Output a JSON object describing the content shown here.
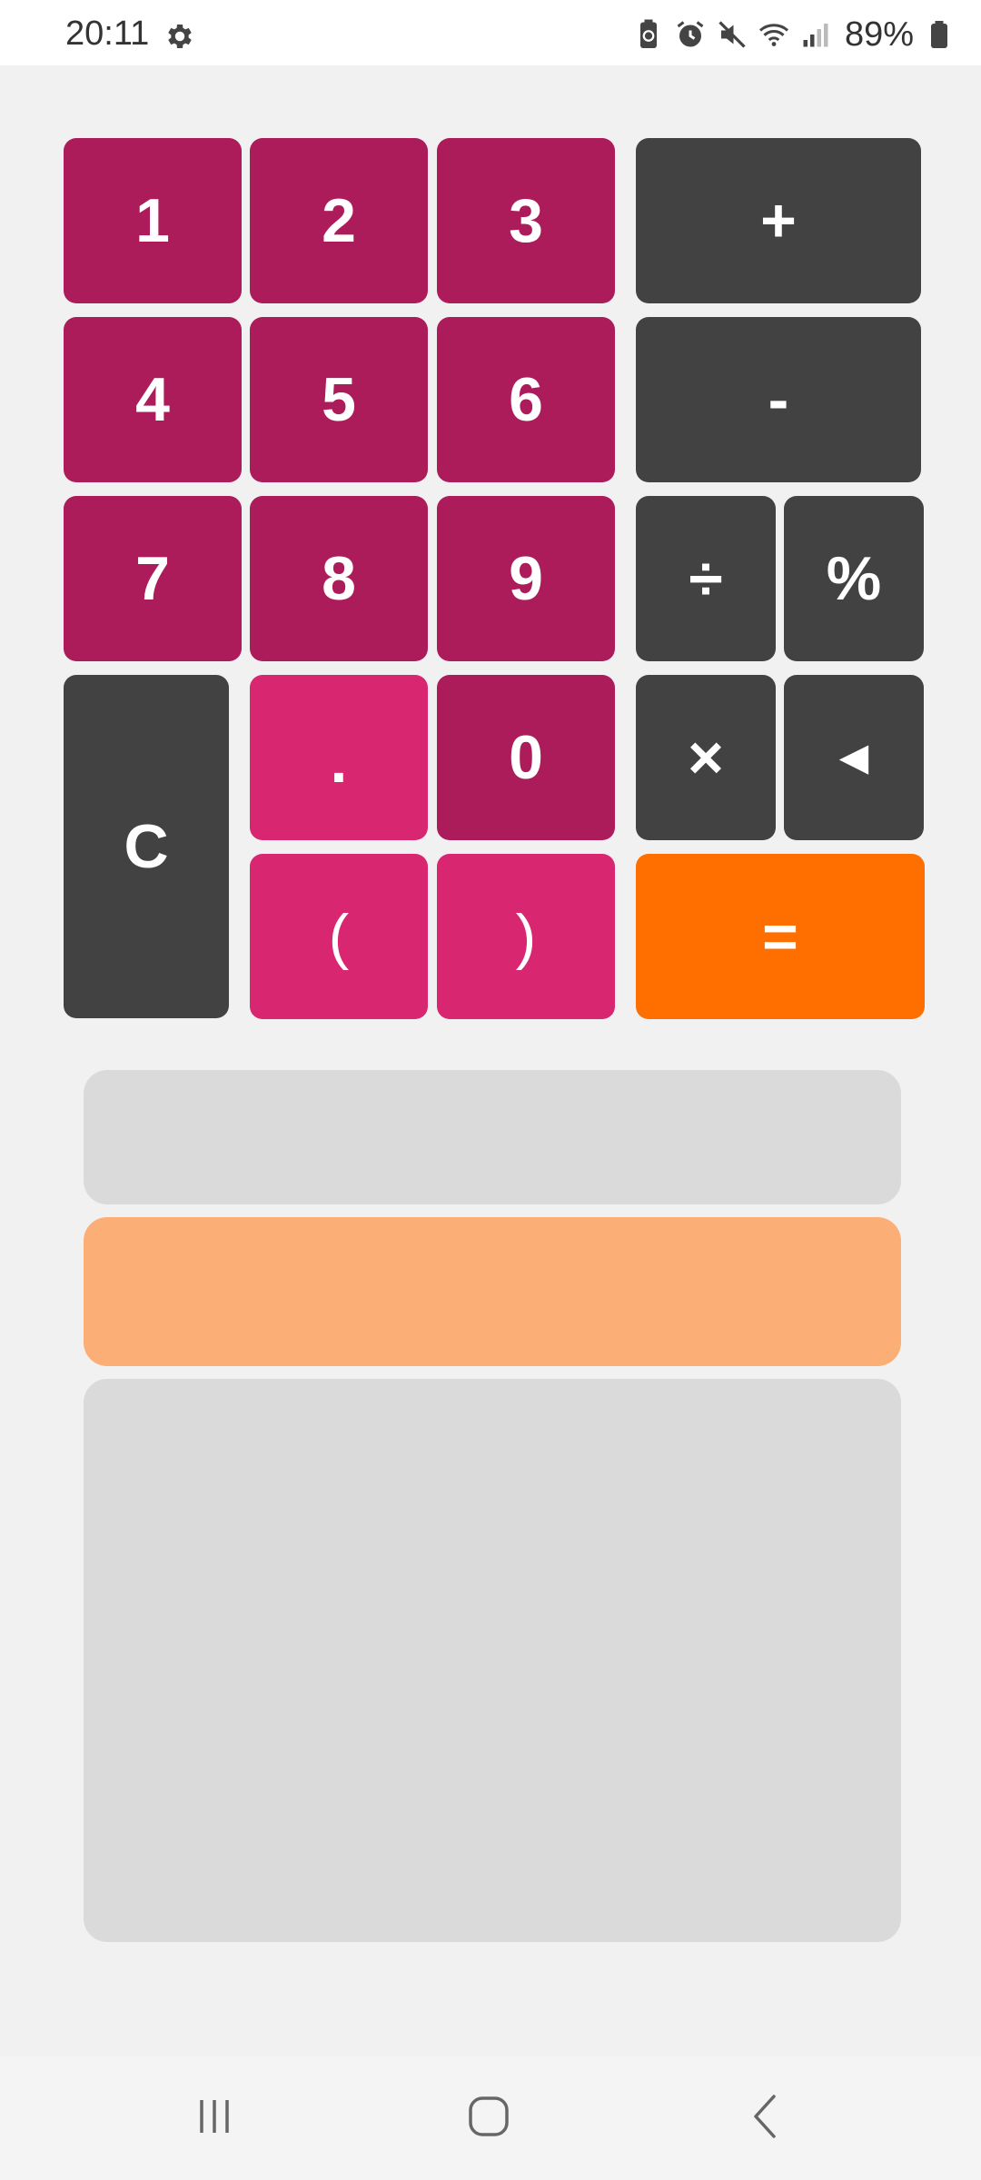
{
  "status_bar": {
    "time": "20:11",
    "battery_percent": "89%",
    "icons": [
      "settings-gear-icon",
      "battery-saver-icon",
      "alarm-icon",
      "mute-icon",
      "wifi-icon",
      "signal-icon",
      "battery-icon"
    ]
  },
  "keypad": {
    "k1": "1",
    "k2": "2",
    "k3": "3",
    "k4": "4",
    "k5": "5",
    "k6": "6",
    "k7": "7",
    "k8": "8",
    "k9": "9",
    "k0": "0",
    "dot": ".",
    "open_paren": "(",
    "close_paren": ")",
    "clear": "C",
    "plus": "+",
    "minus": "-",
    "divide": "÷",
    "percent": "%",
    "multiply": "×",
    "backspace": "◄",
    "equals": "="
  },
  "display": {
    "expression": "",
    "result": "",
    "history": ""
  },
  "colors": {
    "digit": "#ad1c5a",
    "digit_light": "#d82670",
    "operator": "#424242",
    "equals": "#ff6f00",
    "result_panel": "#fbae76",
    "panel": "#dadada",
    "background": "#f1f1f1"
  },
  "nav_bar": {
    "icons": [
      "recent-apps-icon",
      "home-icon",
      "back-icon"
    ]
  }
}
